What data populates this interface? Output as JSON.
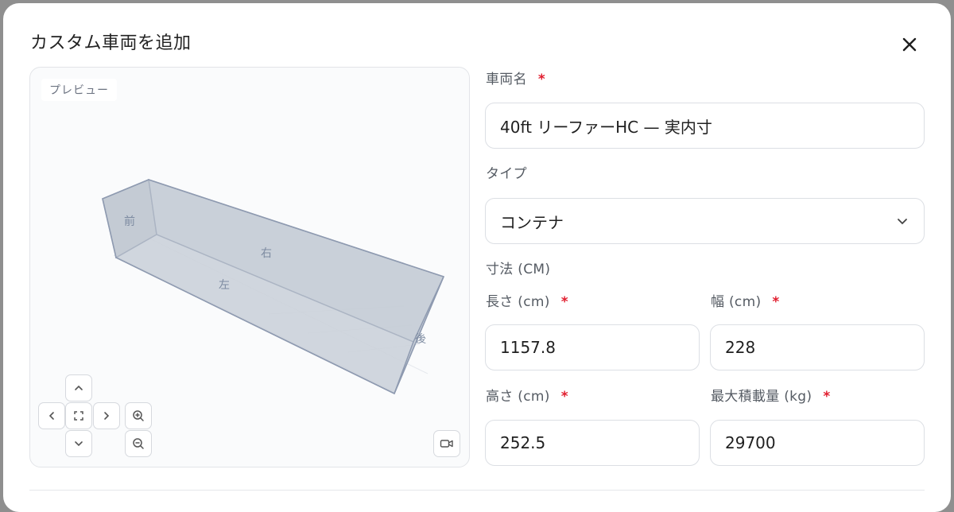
{
  "dialog": {
    "title": "カスタム車両を追加",
    "close_icon": "close-icon"
  },
  "preview": {
    "label": "プレビュー",
    "face_labels": {
      "front": "前",
      "right": "右",
      "left": "左",
      "back": "後"
    },
    "controls": {
      "up": "chevron-up-icon",
      "down": "chevron-down-icon",
      "left": "chevron-left-icon",
      "right": "chevron-right-icon",
      "center": "fit-view-icon",
      "zoom_in": "zoom-in-icon",
      "zoom_out": "zoom-out-icon",
      "camera": "camera-icon"
    }
  },
  "form": {
    "vehicle_name": {
      "label": "車両名",
      "required_mark": "*",
      "value": "40ft リーファーHC — 実内寸"
    },
    "type": {
      "label": "タイプ",
      "value": "コンテナ",
      "icon": "chevron-down-icon"
    },
    "dimensions_section": "寸法 (CM)",
    "length": {
      "label": "長さ (cm)",
      "required_mark": "*",
      "value": "1157.8"
    },
    "width": {
      "label": "幅 (cm)",
      "required_mark": "*",
      "value": "228"
    },
    "height": {
      "label": "高さ (cm)",
      "required_mark": "*",
      "value": "252.5"
    },
    "max_load": {
      "label": "最大積載量 (kg)",
      "required_mark": "*",
      "value": "29700"
    }
  }
}
